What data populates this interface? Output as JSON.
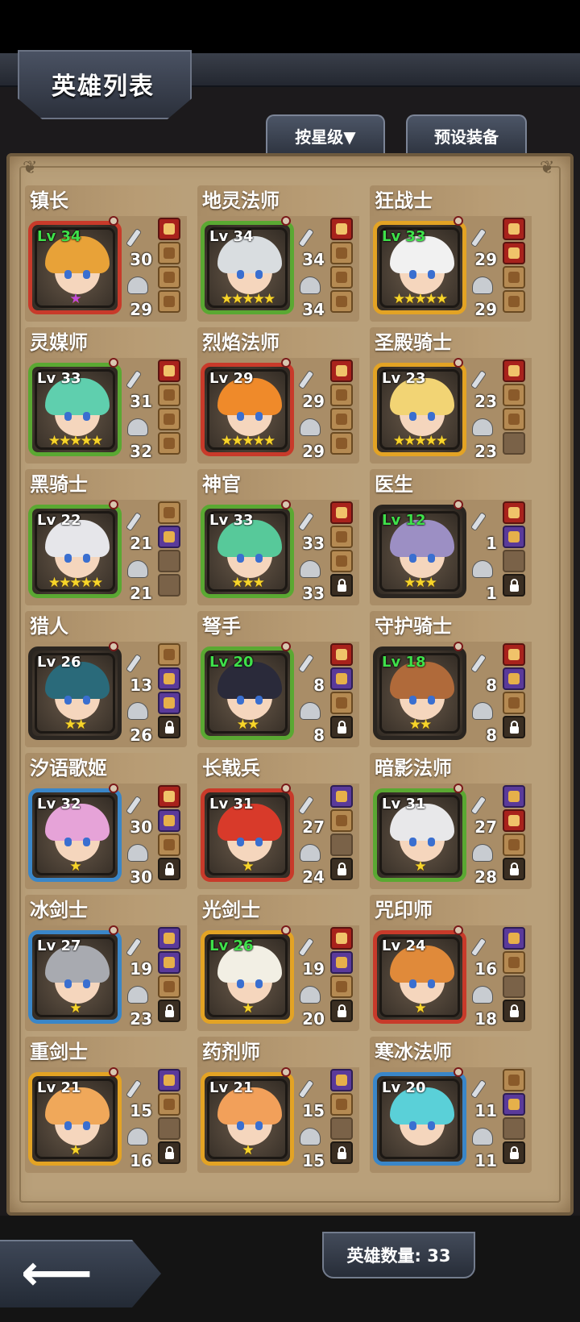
{
  "header": {
    "title": "英雄列表",
    "sort_button": "按星级▼",
    "preset_button": "预设装备"
  },
  "footer": {
    "hero_count_label": "英雄数量: 33",
    "back_icon": "left-arrow-icon"
  },
  "colors": {
    "panel": "#b9a07a",
    "card": "#a98d67",
    "max_level_text": "#3fe04a",
    "star": "#f7d52a"
  },
  "heroes": [
    {
      "name": "镇长",
      "level": "Lv 34",
      "level_max": true,
      "stars": "★",
      "star_count": 1,
      "star_color": "purple",
      "frame": "red",
      "hair": "#e8a238",
      "eye": "#39b54a",
      "attack": "30",
      "defense": "29",
      "slots": [
        "filled-red",
        "filled-tan",
        "filled-tan",
        "filled-tan"
      ]
    },
    {
      "name": "地灵法师",
      "level": "Lv 34",
      "level_max": false,
      "stars": "★★★★★",
      "star_count": 5,
      "frame": "green",
      "hair": "#d9dde0",
      "eye": "#4a8a6a",
      "attack": "34",
      "defense": "34",
      "slots": [
        "filled-red",
        "filled-tan",
        "filled-tan",
        "filled-tan"
      ]
    },
    {
      "name": "狂战士",
      "level": "Lv 33",
      "level_max": true,
      "stars": "★★★★★",
      "star_count": 5,
      "frame": "gold",
      "hair": "#f1f1f1",
      "eye": "#c8261e",
      "attack": "29",
      "defense": "29",
      "slots": [
        "filled-red",
        "filled-red",
        "filled-tan",
        "filled-tan"
      ]
    },
    {
      "name": "灵媒师",
      "level": "Lv 33",
      "level_max": false,
      "stars": "★★★★★",
      "star_count": 5,
      "frame": "green",
      "hair": "#5fcfae",
      "eye": "#c23ab0",
      "attack": "31",
      "defense": "32",
      "slots": [
        "filled-red",
        "filled-tan",
        "filled-tan",
        "filled-tan"
      ]
    },
    {
      "name": "烈焰法师",
      "level": "Lv 29",
      "level_max": false,
      "stars": "★★★★★",
      "star_count": 5,
      "frame": "red",
      "hair": "#ef8a2a",
      "eye": "#b8261e",
      "attack": "29",
      "defense": "29",
      "slots": [
        "filled-red",
        "filled-tan",
        "filled-tan",
        "filled-tan"
      ]
    },
    {
      "name": "圣殿骑士",
      "level": "Lv 23",
      "level_max": false,
      "stars": "★★★★★",
      "star_count": 5,
      "frame": "gold",
      "hair": "#f2d474",
      "eye": "#8a5a1a",
      "attack": "23",
      "defense": "23",
      "slots": [
        "filled-red",
        "filled-tan",
        "filled-tan",
        "empty"
      ]
    },
    {
      "name": "黑骑士",
      "level": "Lv 22",
      "level_max": false,
      "stars": "★★★★★",
      "star_count": 5,
      "frame": "green",
      "hair": "#e6e6ea",
      "eye": "#b0221a",
      "attack": "21",
      "defense": "21",
      "slots": [
        "filled-tan",
        "filled-purple",
        "empty",
        "empty"
      ]
    },
    {
      "name": "神官",
      "level": "Lv 33",
      "level_max": false,
      "stars": "★★★",
      "star_count": 3,
      "frame": "green",
      "hair": "#57c99a",
      "eye": "#3a7ad0",
      "attack": "33",
      "defense": "33",
      "slots": [
        "filled-red",
        "filled-tan",
        "filled-tan",
        "locked"
      ]
    },
    {
      "name": "医生",
      "level": "Lv 12",
      "level_max": true,
      "stars": "★★★",
      "star_count": 3,
      "frame": "black",
      "hair": "#9c8fc4",
      "eye": "#3a86c8",
      "attack": "1",
      "defense": "1",
      "slots": [
        "filled-red",
        "filled-purple",
        "empty",
        "locked"
      ]
    },
    {
      "name": "猎人",
      "level": "Lv 26",
      "level_max": false,
      "stars": "★★",
      "star_count": 2,
      "frame": "black",
      "hair": "#2a6a7a",
      "eye": "#3a3a3a",
      "attack": "13",
      "defense": "26",
      "slots": [
        "filled-tan",
        "filled-purple",
        "filled-purple",
        "locked"
      ]
    },
    {
      "name": "弩手",
      "level": "Lv 20",
      "level_max": true,
      "stars": "★★",
      "star_count": 2,
      "frame": "green",
      "hair": "#2a2a3a",
      "eye": "#2a7a3a",
      "attack": "8",
      "defense": "8",
      "slots": [
        "filled-red",
        "filled-purple",
        "filled-tan",
        "locked"
      ]
    },
    {
      "name": "守护骑士",
      "level": "Lv 18",
      "level_max": true,
      "stars": "★★",
      "star_count": 2,
      "frame": "black",
      "hair": "#b06a3a",
      "eye": "#3a86c8",
      "attack": "8",
      "defense": "8",
      "slots": [
        "filled-red",
        "filled-purple",
        "filled-tan",
        "locked"
      ]
    },
    {
      "name": "汐语歌姬",
      "level": "Lv 32",
      "level_max": false,
      "stars": "★",
      "star_count": 1,
      "frame": "blue",
      "hair": "#e6a3d8",
      "eye": "#3a86c8",
      "attack": "30",
      "defense": "30",
      "slots": [
        "filled-red",
        "filled-purple",
        "filled-tan",
        "locked"
      ]
    },
    {
      "name": "长戟兵",
      "level": "Lv 31",
      "level_max": false,
      "stars": "★",
      "star_count": 1,
      "frame": "red",
      "hair": "#d83a2a",
      "eye": "#8a4a1a",
      "attack": "27",
      "defense": "24",
      "slots": [
        "filled-purple",
        "filled-tan",
        "empty",
        "locked"
      ]
    },
    {
      "name": "暗影法师",
      "level": "Lv 31",
      "level_max": false,
      "stars": "★",
      "star_count": 1,
      "frame": "green",
      "hair": "#e8e8ea",
      "eye": "#c0261e",
      "attack": "27",
      "defense": "28",
      "slots": [
        "filled-purple",
        "filled-red",
        "filled-tan",
        "locked"
      ]
    },
    {
      "name": "冰剑士",
      "level": "Lv 27",
      "level_max": false,
      "stars": "★",
      "star_count": 1,
      "frame": "blue",
      "hair": "#a8aab0",
      "eye": "#c0261e",
      "attack": "19",
      "defense": "23",
      "slots": [
        "filled-purple",
        "filled-purple",
        "filled-tan",
        "locked"
      ]
    },
    {
      "name": "光剑士",
      "level": "Lv 26",
      "level_max": true,
      "stars": "★",
      "star_count": 1,
      "frame": "gold",
      "hair": "#f2efe4",
      "eye": "#d88a2a",
      "attack": "19",
      "defense": "20",
      "slots": [
        "filled-red",
        "filled-purple",
        "filled-tan",
        "locked"
      ]
    },
    {
      "name": "咒印师",
      "level": "Lv 24",
      "level_max": false,
      "stars": "★",
      "star_count": 1,
      "frame": "red",
      "hair": "#e08a3a",
      "eye": "#c88a2a",
      "attack": "16",
      "defense": "18",
      "slots": [
        "filled-purple",
        "filled-tan",
        "empty",
        "locked"
      ]
    },
    {
      "name": "重剑士",
      "level": "Lv 21",
      "level_max": false,
      "stars": "★",
      "star_count": 1,
      "frame": "gold",
      "hair": "#f0a85a",
      "eye": "#c0361e",
      "attack": "15",
      "defense": "16",
      "slots": [
        "filled-purple",
        "filled-tan",
        "empty",
        "locked"
      ]
    },
    {
      "name": "药剂师",
      "level": "Lv 21",
      "level_max": false,
      "stars": "★",
      "star_count": 1,
      "frame": "gold",
      "hair": "#f2a05a",
      "eye": "#5a4a3a",
      "attack": "15",
      "defense": "15",
      "slots": [
        "filled-purple",
        "filled-tan",
        "empty",
        "locked"
      ]
    },
    {
      "name": "寒冰法师",
      "level": "Lv 20",
      "level_max": false,
      "stars": "",
      "star_count": 0,
      "frame": "blue",
      "hair": "#5ad0d8",
      "eye": "#3a86c8",
      "attack": "11",
      "defense": "11",
      "slots": [
        "filled-tan",
        "filled-purple",
        "empty",
        "locked"
      ]
    }
  ]
}
